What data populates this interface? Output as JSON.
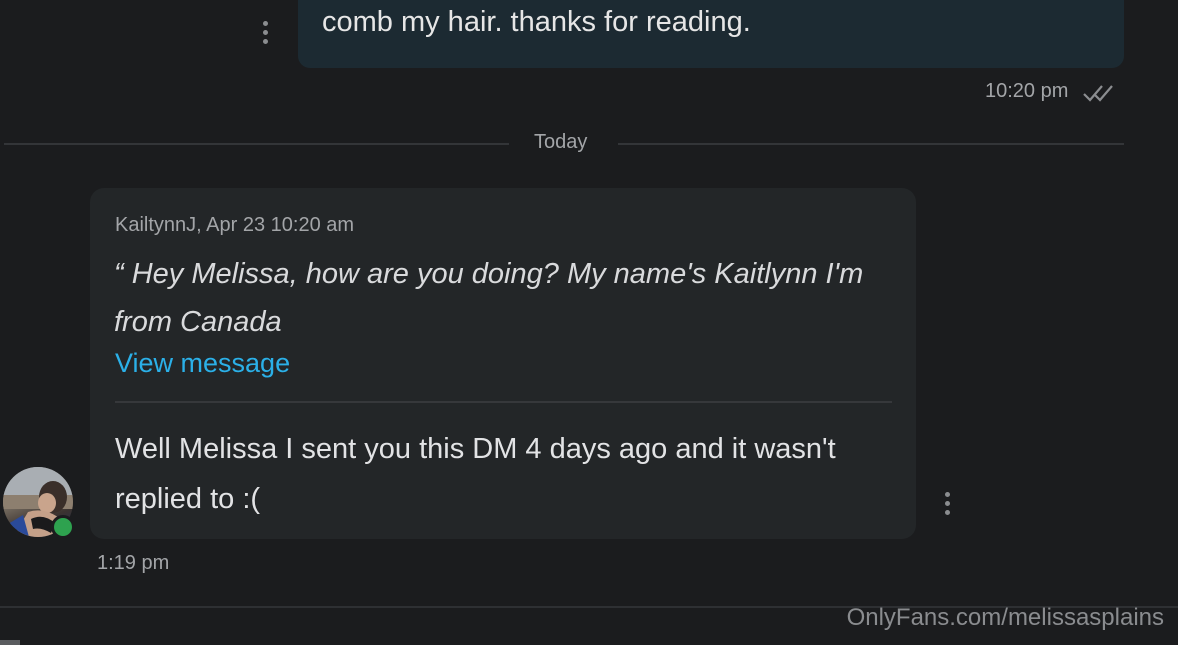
{
  "outgoing": {
    "text": "comb my hair. thanks for reading.",
    "time": "10:20 pm",
    "status_icon": "double-check-icon"
  },
  "divider": {
    "label": "Today"
  },
  "incoming": {
    "quote_meta": "KailtynnJ, Apr 23 10:20 am",
    "quote_text": "“ Hey Melissa, how are you doing? My name's Kaitlynn I'm from Canada",
    "view_link": "View message",
    "message": "Well Melissa I sent you this DM 4 days ago and it wasn't replied to :(",
    "time": "1:19 pm",
    "online": true
  },
  "watermark": "OnlyFans.com/melissasplains",
  "colors": {
    "background": "#1b1c1e",
    "outgoing_bubble": "#1c2a32",
    "incoming_card": "#232628",
    "link": "#2bb0e8",
    "online": "#2ea24f"
  }
}
